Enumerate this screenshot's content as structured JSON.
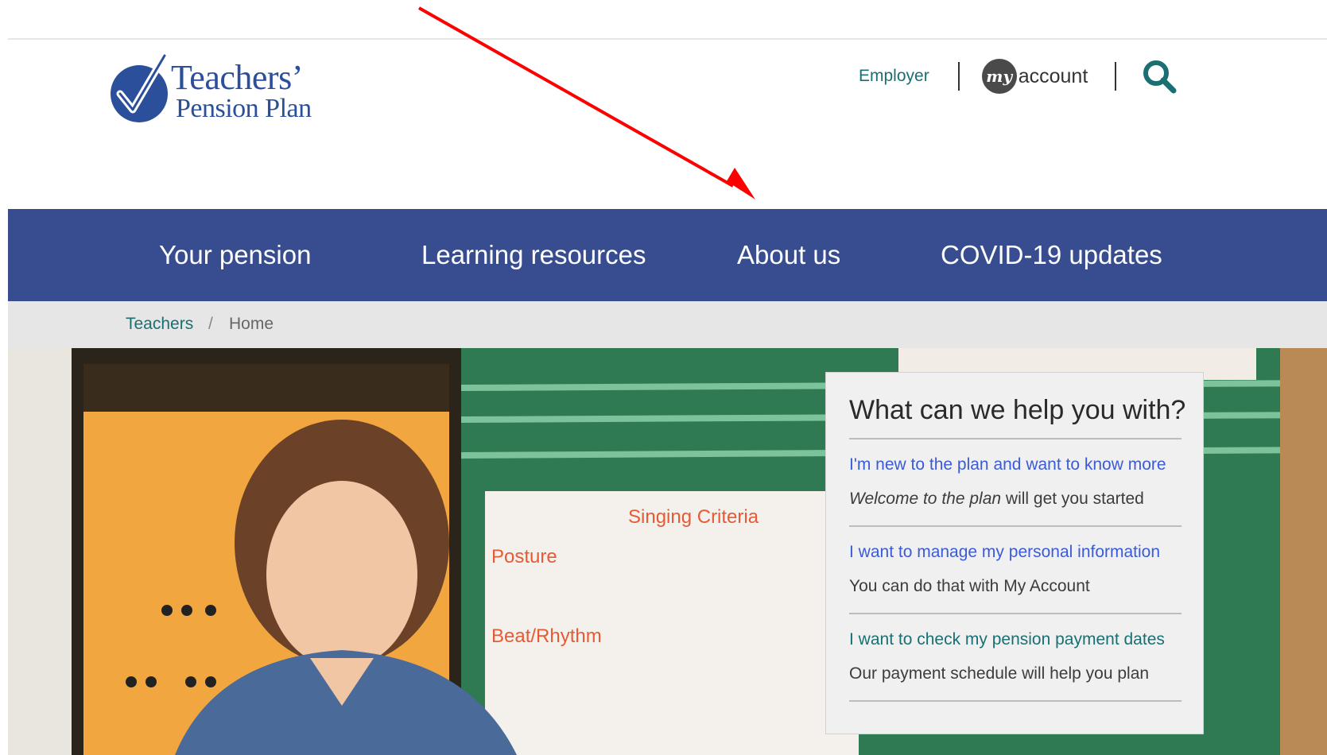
{
  "colors": {
    "nav_bg": "#384d8f",
    "link_teal": "#1a6f73",
    "link_blue": "#3b5bd8",
    "breadcrumb_bg": "#e6e6e6",
    "annotation_arrow": "#ff0000"
  },
  "logo": {
    "line1": "Teachers’",
    "line2": "Pension Plan"
  },
  "utility_nav": {
    "employer_label": "Employer",
    "my_badge": "my",
    "account_label": "account",
    "search_icon": "search-icon"
  },
  "main_nav": {
    "items": [
      {
        "label": "Your pension"
      },
      {
        "label": "Learning resources"
      },
      {
        "label": "About us"
      },
      {
        "label": "COVID-19 updates"
      }
    ]
  },
  "breadcrumb": {
    "parent": "Teachers",
    "separator": "/",
    "current": "Home"
  },
  "hero": {
    "image": "teacher-in-music-classroom"
  },
  "help_panel": {
    "title": "What can we help you with?",
    "items": [
      {
        "link": "I'm new to the plan and want to know more",
        "desc_em": "Welcome to the plan",
        "desc": " will get you started"
      },
      {
        "link": "I want to manage my personal information",
        "desc_em": "",
        "desc": "You can do that with My Account"
      },
      {
        "link": "I want to check my pension payment dates",
        "desc_em": "",
        "desc": "Our payment schedule will help you plan"
      }
    ]
  }
}
